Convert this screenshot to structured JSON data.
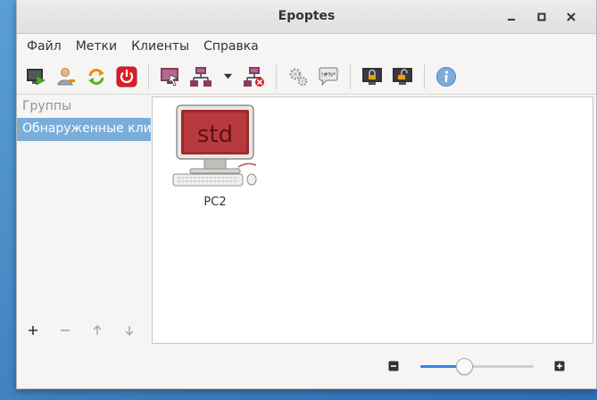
{
  "window": {
    "title": "Epoptes"
  },
  "menu": [
    "Файл",
    "Метки",
    "Клиенты",
    "Справка"
  ],
  "toolbar": {
    "icons": [
      "monitor-play-icon",
      "user-icon",
      "reboot-icon",
      "power-icon",
      "broadcast-icon",
      "network-icon",
      "dropdown-arrow-icon",
      "network-stop-icon",
      "gears-icon",
      "message-icon",
      "lock-screen-icon",
      "unlock-screen-icon",
      "info-icon"
    ]
  },
  "sidebar": {
    "header": "Группы",
    "items": [
      {
        "label": "Обнаруженные клие"
      }
    ]
  },
  "clients": [
    {
      "label": "PC2",
      "screen_text": "std"
    }
  ],
  "zoom": {
    "value": 0.37
  },
  "colors": {
    "selection": "#7aaed8",
    "power": "#e01b24",
    "accent": "#3584e4"
  }
}
